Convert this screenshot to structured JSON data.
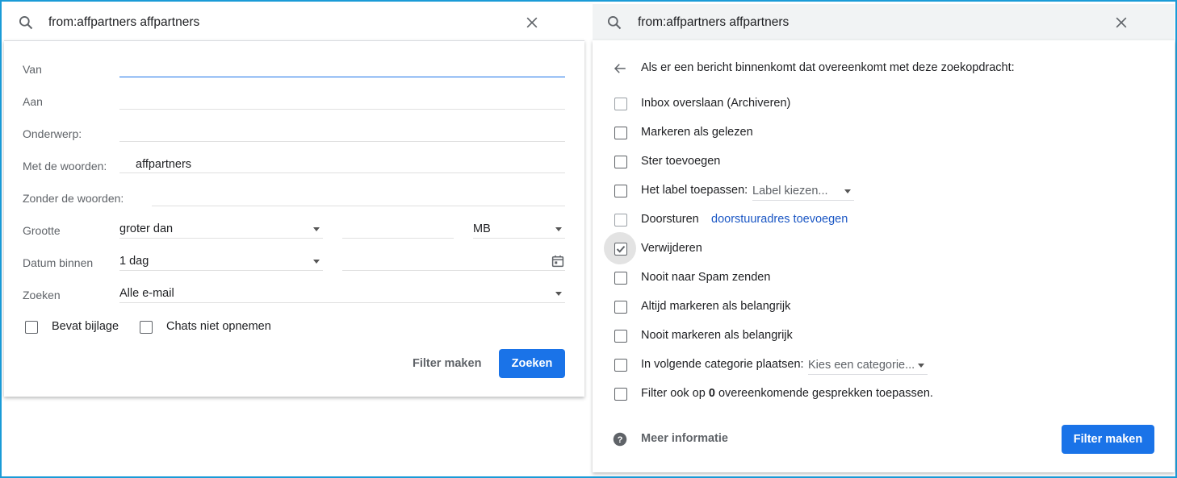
{
  "left": {
    "search_query": "from:affpartners affpartners",
    "labels": {
      "from": "Van",
      "to": "Aan",
      "subject": "Onderwerp:",
      "has_words": "Met de woorden:",
      "without_words": "Zonder de woorden:",
      "size": "Grootte",
      "date_within": "Datum binnen",
      "search_in": "Zoeken"
    },
    "values": {
      "from": "",
      "to": "",
      "subject": "",
      "has_words": "affpartners",
      "without_words": "",
      "size_operator": "groter dan",
      "size_value": "",
      "size_unit": "MB",
      "date_range": "1 dag",
      "date_value": "",
      "search_scope": "Alle e-mail"
    },
    "checkboxes": {
      "has_attachment": "Bevat bijlage",
      "exclude_chats": "Chats niet opnemen"
    },
    "buttons": {
      "create_filter": "Filter maken",
      "search": "Zoeken"
    }
  },
  "right": {
    "search_query": "from:affpartners affpartners",
    "heading": "Als er een bericht binnenkomt dat overeenkomt met deze zoekopdracht:",
    "options": [
      {
        "label": "Inbox overslaan (Archiveren)",
        "checked": false
      },
      {
        "label": "Markeren als gelezen",
        "checked": false
      },
      {
        "label": "Ster toevoegen",
        "checked": false
      },
      {
        "label": "Het label toepassen:",
        "checked": false
      },
      {
        "label": "Doorsturen",
        "checked": false
      },
      {
        "label": "Verwijderen",
        "checked": true
      },
      {
        "label": "Nooit naar Spam zenden",
        "checked": false
      },
      {
        "label": "Altijd markeren als belangrijk",
        "checked": false
      },
      {
        "label": "Nooit markeren als belangrijk",
        "checked": false
      },
      {
        "label": "In volgende categorie plaatsen:",
        "checked": false
      },
      {
        "label": "Filter ook op",
        "checked": false
      }
    ],
    "label_dropdown": "Label kiezen...",
    "forward_link": "doorstuuradres toevoegen",
    "category_dropdown": "Kies een categorie...",
    "apply_count": "0",
    "apply_suffix": "overeenkomende gesprekken toepassen.",
    "more_info": "Meer informatie",
    "create_filter": "Filter maken"
  },
  "colors": {
    "accent": "#1a73e8",
    "frame": "#1a9bd7",
    "link": "#1a56c4"
  }
}
